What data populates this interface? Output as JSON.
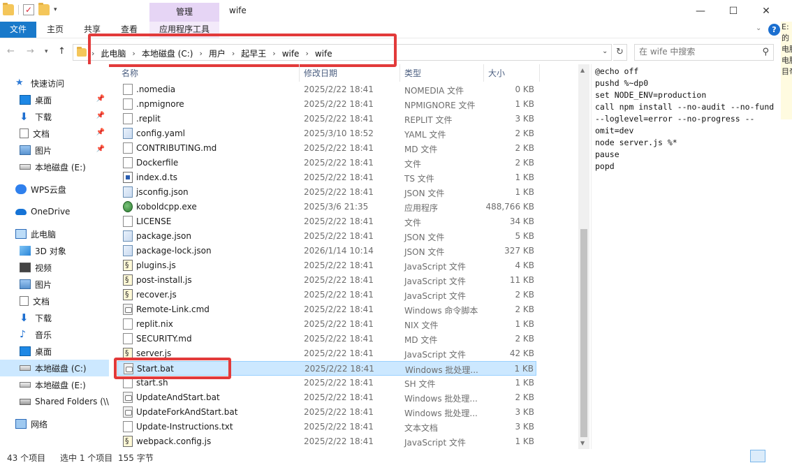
{
  "window": {
    "title": "wife",
    "context_tab": "管理",
    "controls": {
      "minimize": "—",
      "maximize": "☐",
      "close": "✕"
    }
  },
  "ribbon": {
    "tabs": [
      "文件",
      "主页",
      "共享",
      "查看",
      "应用程序工具"
    ],
    "help": "?"
  },
  "address": {
    "crumbs": [
      "此电脑",
      "本地磁盘 (C:)",
      "用户",
      "起早王",
      "wife",
      "wife"
    ],
    "search_placeholder": "在 wife 中搜索"
  },
  "nav_pane": {
    "items": [
      {
        "label": "快速访问",
        "icon": "star-icon"
      },
      {
        "label": "桌面",
        "icon": "desktop-icon",
        "pinned": true
      },
      {
        "label": "下载",
        "icon": "download-icon",
        "pinned": true
      },
      {
        "label": "文档",
        "icon": "document-icon",
        "pinned": true
      },
      {
        "label": "图片",
        "icon": "picture-icon",
        "pinned": true
      },
      {
        "label": "本地磁盘 (E:)",
        "icon": "drive-icon"
      },
      {
        "label": "WPS云盘",
        "icon": "cloud-icon"
      },
      {
        "label": "OneDrive",
        "icon": "onedrive-icon"
      },
      {
        "label": "此电脑",
        "icon": "computer-icon"
      },
      {
        "label": "3D 对象",
        "icon": "cube-icon"
      },
      {
        "label": "视频",
        "icon": "video-icon"
      },
      {
        "label": "图片",
        "icon": "picture-icon"
      },
      {
        "label": "文档",
        "icon": "document-icon"
      },
      {
        "label": "下载",
        "icon": "download-icon"
      },
      {
        "label": "音乐",
        "icon": "music-icon"
      },
      {
        "label": "桌面",
        "icon": "desktop-icon"
      },
      {
        "label": "本地磁盘 (C:)",
        "icon": "drive-icon",
        "selected": true
      },
      {
        "label": "本地磁盘 (E:)",
        "icon": "drive-icon"
      },
      {
        "label": "Shared Folders (\\\\",
        "icon": "network-drive-icon"
      },
      {
        "label": "网络",
        "icon": "network-icon"
      }
    ]
  },
  "file_list": {
    "columns": {
      "name": "名称",
      "date": "修改日期",
      "type": "类型",
      "size": "大小"
    },
    "rows": [
      {
        "name": ".nomedia",
        "date": "2025/2/22 18:41",
        "type": "NOMEDIA 文件",
        "size": "0 KB",
        "icon": "file"
      },
      {
        "name": ".npmignore",
        "date": "2025/2/22 18:41",
        "type": "NPMIGNORE 文件",
        "size": "1 KB",
        "icon": "file"
      },
      {
        "name": ".replit",
        "date": "2025/2/22 18:41",
        "type": "REPLIT 文件",
        "size": "3 KB",
        "icon": "file"
      },
      {
        "name": "config.yaml",
        "date": "2025/3/10 18:52",
        "type": "YAML 文件",
        "size": "2 KB",
        "icon": "config"
      },
      {
        "name": "CONTRIBUTING.md",
        "date": "2025/2/22 18:41",
        "type": "MD 文件",
        "size": "2 KB",
        "icon": "file"
      },
      {
        "name": "Dockerfile",
        "date": "2025/2/22 18:41",
        "type": "文件",
        "size": "2 KB",
        "icon": "file"
      },
      {
        "name": "index.d.ts",
        "date": "2025/2/22 18:41",
        "type": "TS 文件",
        "size": "1 KB",
        "icon": "ts"
      },
      {
        "name": "jsconfig.json",
        "date": "2025/2/22 18:41",
        "type": "JSON 文件",
        "size": "1 KB",
        "icon": "config"
      },
      {
        "name": "koboldcpp.exe",
        "date": "2025/3/6 21:35",
        "type": "应用程序",
        "size": "488,766 KB",
        "icon": "exe"
      },
      {
        "name": "LICENSE",
        "date": "2025/2/22 18:41",
        "type": "文件",
        "size": "34 KB",
        "icon": "file"
      },
      {
        "name": "package.json",
        "date": "2025/2/22 18:41",
        "type": "JSON 文件",
        "size": "5 KB",
        "icon": "config"
      },
      {
        "name": "package-lock.json",
        "date": "2026/1/14 10:14",
        "type": "JSON 文件",
        "size": "327 KB",
        "icon": "config"
      },
      {
        "name": "plugins.js",
        "date": "2025/2/22 18:41",
        "type": "JavaScript 文件",
        "size": "4 KB",
        "icon": "js"
      },
      {
        "name": "post-install.js",
        "date": "2025/2/22 18:41",
        "type": "JavaScript 文件",
        "size": "11 KB",
        "icon": "js"
      },
      {
        "name": "recover.js",
        "date": "2025/2/22 18:41",
        "type": "JavaScript 文件",
        "size": "2 KB",
        "icon": "js"
      },
      {
        "name": "Remote-Link.cmd",
        "date": "2025/2/22 18:41",
        "type": "Windows 命令脚本",
        "size": "2 KB",
        "icon": "bat"
      },
      {
        "name": "replit.nix",
        "date": "2025/2/22 18:41",
        "type": "NIX 文件",
        "size": "1 KB",
        "icon": "file"
      },
      {
        "name": "SECURITY.md",
        "date": "2025/2/22 18:41",
        "type": "MD 文件",
        "size": "2 KB",
        "icon": "file"
      },
      {
        "name": "server.js",
        "date": "2025/2/22 18:41",
        "type": "JavaScript 文件",
        "size": "42 KB",
        "icon": "js"
      },
      {
        "name": "Start.bat",
        "date": "2025/2/22 18:41",
        "type": "Windows 批处理...",
        "size": "1 KB",
        "icon": "bat",
        "selected": true
      },
      {
        "name": "start.sh",
        "date": "2025/2/22 18:41",
        "type": "SH 文件",
        "size": "1 KB",
        "icon": "file"
      },
      {
        "name": "UpdateAndStart.bat",
        "date": "2025/2/22 18:41",
        "type": "Windows 批处理...",
        "size": "2 KB",
        "icon": "bat"
      },
      {
        "name": "UpdateForkAndStart.bat",
        "date": "2025/2/22 18:41",
        "type": "Windows 批处理...",
        "size": "3 KB",
        "icon": "bat"
      },
      {
        "name": "Update-Instructions.txt",
        "date": "2025/2/22 18:41",
        "type": "文本文档",
        "size": "3 KB",
        "icon": "file"
      },
      {
        "name": "webpack.config.js",
        "date": "2025/2/22 18:41",
        "type": "JavaScript 文件",
        "size": "1 KB",
        "icon": "js"
      }
    ]
  },
  "preview": {
    "text": "@echo off\npushd %~dp0\nset NODE_ENV=production\ncall npm install --no-audit --no-fund\n--loglevel=error --no-progress --\nomit=dev\nnode server.js %*\npause\npopd"
  },
  "right_edge_text": "E:\n的\n电脑\n电脑\n目帝",
  "status": {
    "count": "43 个项目",
    "selected": "选中 1 个项目",
    "size": "155 字节"
  },
  "colors": {
    "accent": "#1979ca",
    "selection": "#cce8ff",
    "highlight": "#e23a3a",
    "manage_tab": "#e6d5f5"
  }
}
